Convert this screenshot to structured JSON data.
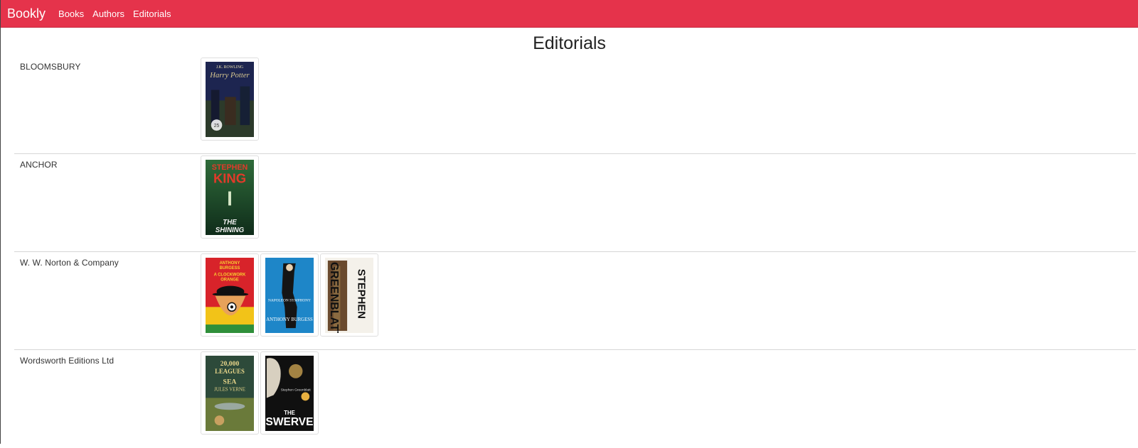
{
  "navbar": {
    "brand": "Bookly",
    "links": [
      "Books",
      "Authors",
      "Editorials"
    ],
    "color": "#e5334b"
  },
  "page": {
    "title": "Editorials"
  },
  "editorials": [
    {
      "name": "BLOOMSBURY",
      "covers": [
        "harry-potter-cover"
      ]
    },
    {
      "name": "ANCHOR",
      "covers": [
        "the-shining-cover"
      ]
    },
    {
      "name": "W. W. Norton & Company",
      "covers": [
        "clockwork-orange-cover",
        "napoleon-symphony-cover",
        "greenblatt-cover"
      ]
    },
    {
      "name": "Wordsworth Editions Ltd",
      "covers": [
        "twenty-thousand-leagues-cover",
        "the-swerve-cover"
      ]
    }
  ]
}
